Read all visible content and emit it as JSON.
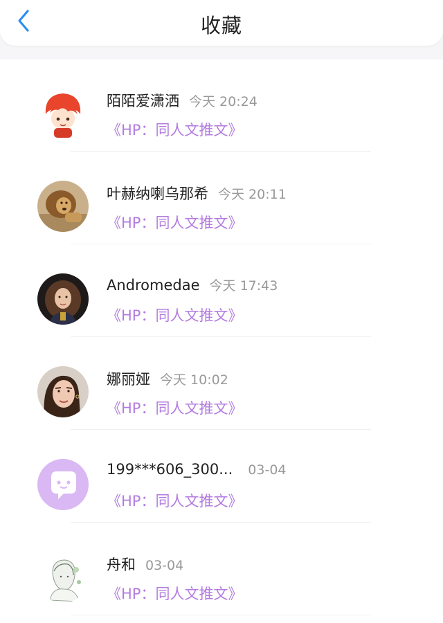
{
  "header": {
    "title": "收藏",
    "back_icon": "chevron-left-icon",
    "accent": "#2b8ff0"
  },
  "colors": {
    "link": "#b37be0",
    "time": "#999999",
    "name": "#222222"
  },
  "favorites": [
    {
      "name": "陌陌爱潇洒",
      "time": "今天 20:24",
      "post": "《HP：同人文推文》",
      "avatar": "red-hair-anime-avatar"
    },
    {
      "name": "叶赫纳喇乌那希",
      "time": "今天 20:11",
      "post": "《HP：同人文推文》",
      "avatar": "lion-avatar"
    },
    {
      "name": "Andromedae",
      "time": "今天 17:43",
      "post": "《HP：同人文推文》",
      "avatar": "curly-hair-girl-avatar"
    },
    {
      "name": "娜丽娅",
      "time": "今天 10:02",
      "post": "《HP：同人文推文》",
      "avatar": "woman-portrait-avatar"
    },
    {
      "name": "199***606_300...",
      "time": "03-04",
      "post": "《HP：同人文推文》",
      "avatar": "default-chat-bubble-avatar"
    },
    {
      "name": "舟和",
      "time": "03-04",
      "post": "《HP：同人文推文》",
      "avatar": "sketch-girl-avatar"
    }
  ]
}
